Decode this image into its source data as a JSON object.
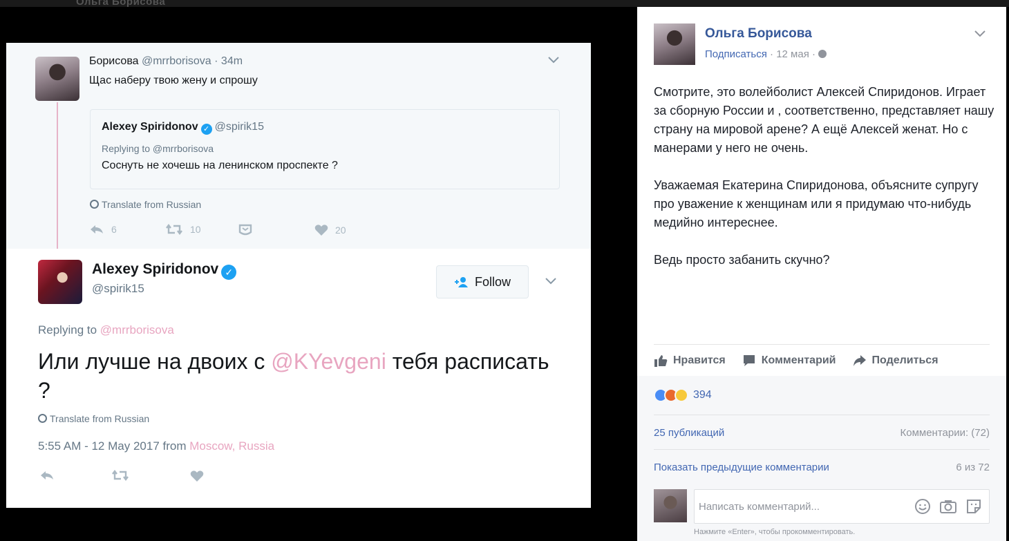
{
  "top_strip": {
    "ghost_title": "Ольга Борисова"
  },
  "twitter": {
    "reply_tweet": {
      "name": "Борисова",
      "handle": "@mrrborisova",
      "time": "· 34m",
      "text": "Щас наберу твою жену и спрошу",
      "quoted": {
        "name": "Alexey Spiridonov",
        "handle": "@spirik15",
        "replying_to": "Replying to @mrrborisova",
        "text": "Соснуть не хочешь на ленинском проспекте ?"
      },
      "translate": "Translate from Russian",
      "replies": "6",
      "retweets": "10",
      "likes": "20"
    },
    "main_tweet": {
      "name": "Alexey Spiridonov",
      "handle": "@spirik15",
      "follow_label": "Follow",
      "replying_prefix": "Replying to",
      "replying_handle": "@mrrborisova",
      "text_before": "Или лучше на двоих с",
      "text_mention": "@KYevgeni",
      "text_after": "тебя расписать ?",
      "translate": "Translate from Russian",
      "timestamp": "5:55 AM - 12 May 2017 from",
      "location": "Moscow, Russia"
    }
  },
  "facebook": {
    "author": "Ольга Борисова",
    "subscribe": "Подписаться",
    "date": "· 12 мая ·",
    "paragraphs": [
      "Смотрите, это волейболист Алексей Спиридонов. Играет за сборную России и , соответственно, представляет нашу страну на мировой арене? А ещё Алексей женат. Но с манерами у него не очень.",
      "Уважаемая Екатерина Спиридонова, объясните супругу про уважение к женщинам или я придумаю что-нибудь медийно интереснее.",
      "Ведь просто забанить скучно?"
    ],
    "actions": {
      "like": "Нравится",
      "comment": "Комментарий",
      "share": "Поделиться"
    },
    "reactions_count": "394",
    "shares": "25 публикаций",
    "comments_count": "Комментарии: (72)",
    "show_previous": "Показать предыдущие комментарии",
    "shown_of": "6 из 72",
    "comment_placeholder": "Написать комментарий...",
    "comment_hint": "Нажмите «Enter», чтобы прокомментировать."
  }
}
